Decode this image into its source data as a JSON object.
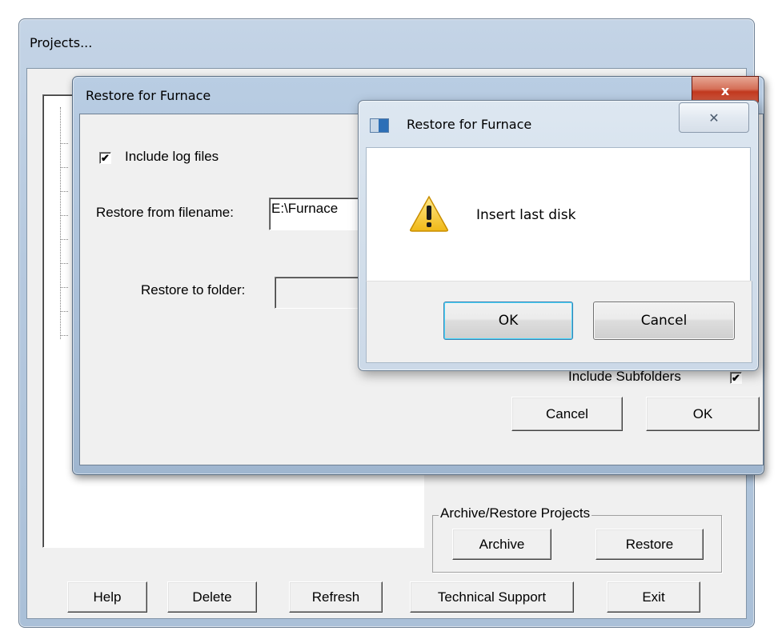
{
  "projects_window": {
    "title": "Projects...",
    "group_label": "Archive/Restore Projects",
    "archive_label": "Archive",
    "restore_label": "Restore",
    "buttons": {
      "help": "Help",
      "delete": "Delete",
      "refresh": "Refresh",
      "tech_support": "Technical Support",
      "exit": "Exit"
    }
  },
  "restore_dialog": {
    "title": "Restore for Furnace",
    "close_glyph": "x",
    "include_log_files_label": "Include log files",
    "include_log_files_checked": true,
    "checkmark": "✔",
    "restore_from_label": "Restore from filename:",
    "restore_from_value": "E:\\Furnace",
    "restore_to_label": "Restore to folder:",
    "restore_to_value": "",
    "include_subfolders_label": "Include Subfolders",
    "include_subfolders_checked": true,
    "cancel_label": "Cancel",
    "ok_label": "OK"
  },
  "message_box": {
    "title": "Restore for Furnace",
    "close_glyph": "✕",
    "icon": "warning-icon",
    "message": "Insert last disk",
    "ok_label": "OK",
    "cancel_label": "Cancel"
  },
  "colors": {
    "aero_frame": "#b6c9df",
    "close_red": "#c2391f",
    "dialog_bg": "#f0f0f0",
    "warning_yellow": "#f4c430"
  }
}
